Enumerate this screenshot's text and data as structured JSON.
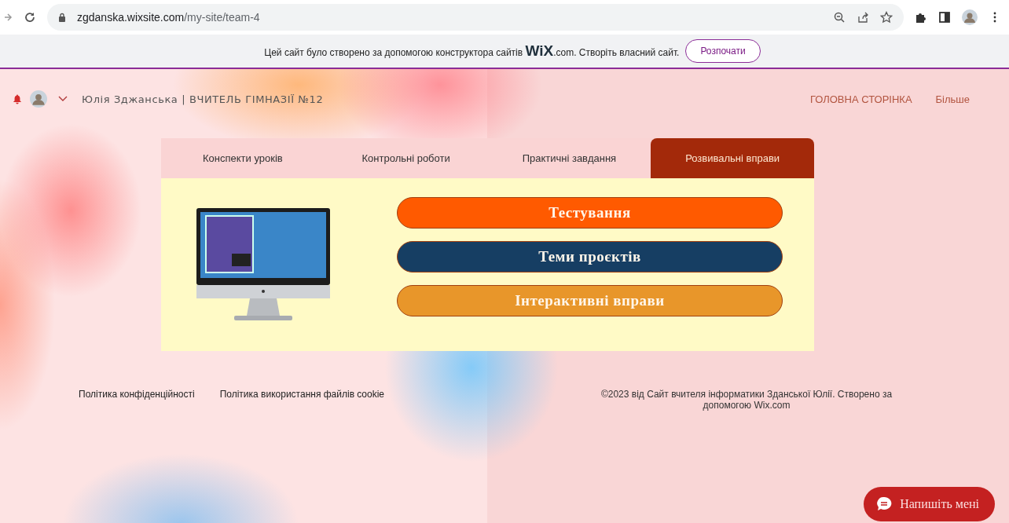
{
  "browser": {
    "url_host": "zgdanska.wixsite.com",
    "url_path": "/my-site/team-4"
  },
  "banner": {
    "text": "Цей сайт було створено за допомогою конструктора сайтів **WiX**.com. Створіть власний сайт.",
    "button": "Розпочати"
  },
  "header": {
    "site_title": "Юлія Зджанська | ВЧИТЕЛЬ ГІМНАЗІЇ №12",
    "nav": [
      "ГОЛОВНА СТОРІНКА",
      "Більше"
    ]
  },
  "tabs": [
    {
      "label": "Конспекти уроків",
      "selected": false
    },
    {
      "label": "Контрольні роботи",
      "selected": false
    },
    {
      "label": "Практичні завдання",
      "selected": false
    },
    {
      "label": "Розвивальні вправи",
      "selected": true
    }
  ],
  "buttons": [
    {
      "label": "Тестування",
      "color": "#ff5a00"
    },
    {
      "label": "Теми проєктів",
      "color": "#163e63"
    },
    {
      "label": "Інтерактивні вправи",
      "color": "#e8962a"
    }
  ],
  "footer": {
    "links": [
      "Політика конфіденційності",
      "Політика використання файлів cookie"
    ],
    "copyright": "©2023 від Сайт вчителя інформатики Зданської Юлії. Створено за допомогою Wix.com"
  },
  "chat": {
    "label": "Напишіть мені"
  }
}
